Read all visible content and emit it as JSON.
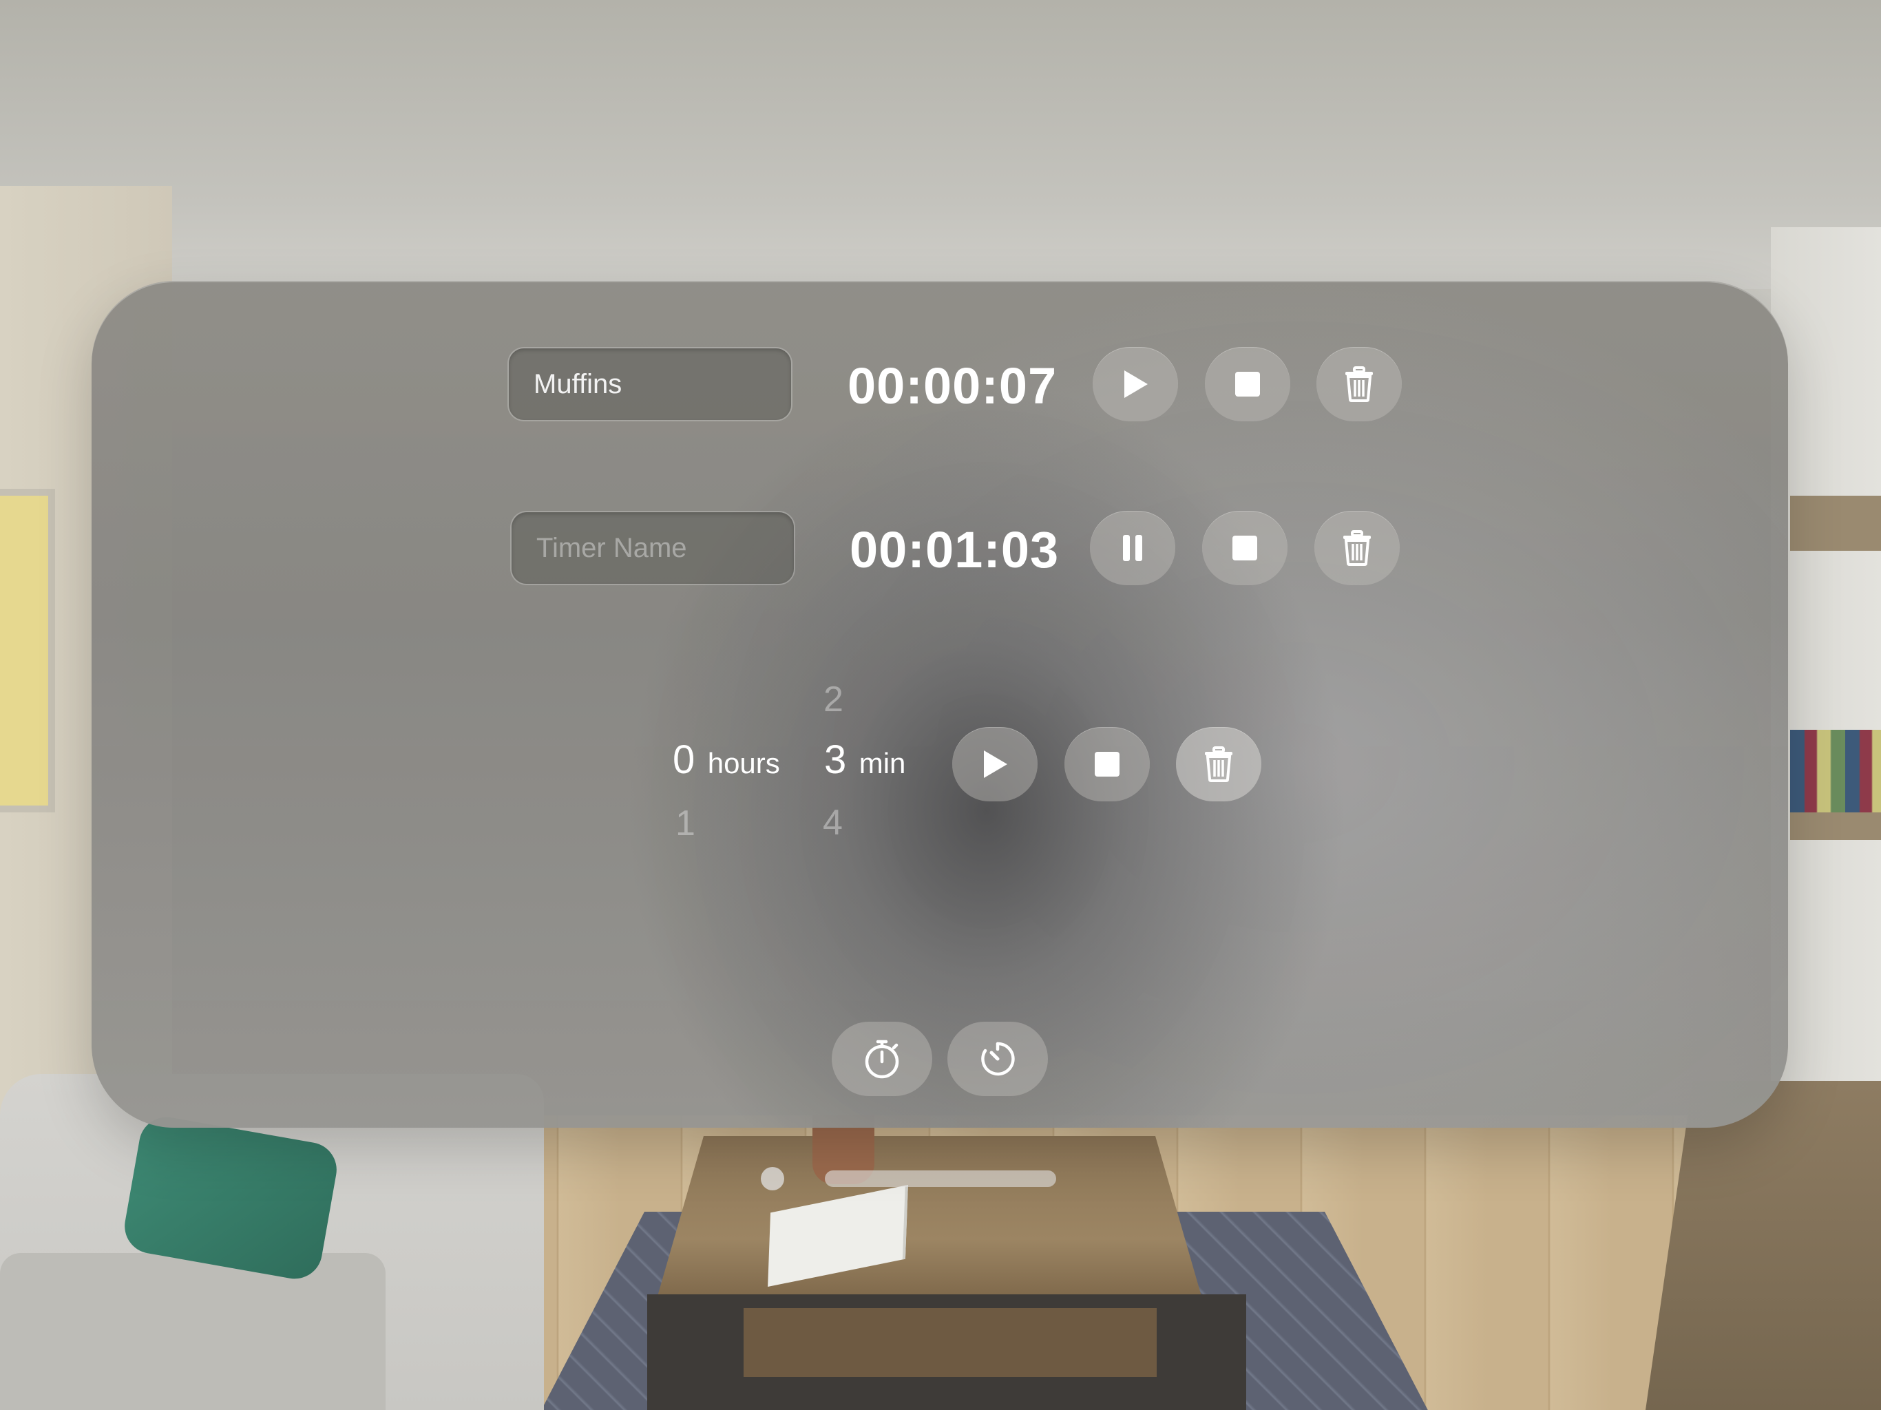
{
  "timers": [
    {
      "name_value": "Muffins",
      "name_placeholder": "Timer Name",
      "time": "00:00:07",
      "state": "paused",
      "primary_icon": "play-icon"
    },
    {
      "name_value": "",
      "name_placeholder": "Timer Name",
      "time": "00:01:03",
      "state": "running",
      "primary_icon": "pause-icon"
    }
  ],
  "picker": {
    "hours": {
      "above": "",
      "selected": "0",
      "below": "1",
      "unit": "hours"
    },
    "minutes": {
      "above": "2",
      "selected": "3",
      "below": "4",
      "unit": "min"
    }
  },
  "tabs": [
    {
      "icon": "stopwatch-icon"
    },
    {
      "icon": "timer-icon"
    }
  ],
  "colors": {
    "glass": "#8e8c86",
    "button": "#bdbcb9",
    "text": "#ffffff"
  }
}
